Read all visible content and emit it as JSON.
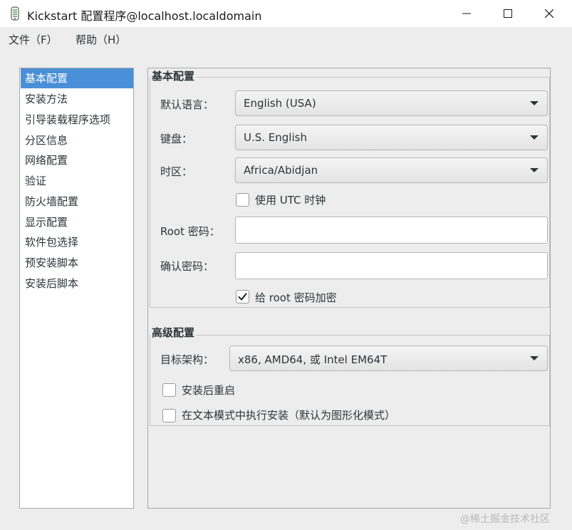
{
  "window": {
    "title": "Kickstart 配置程序@localhost.localdomain",
    "icon": "kickstart-app-icon",
    "controls": [
      "minimize-icon",
      "maximize-icon",
      "close-icon"
    ]
  },
  "menubar": {
    "file": "文件（F）",
    "help": "帮助（H）"
  },
  "sidebar": {
    "items": [
      {
        "label": "基本配置",
        "selected": true
      },
      {
        "label": "安装方法"
      },
      {
        "label": "引导装载程序选项"
      },
      {
        "label": "分区信息"
      },
      {
        "label": "网络配置"
      },
      {
        "label": "验证"
      },
      {
        "label": "防火墙配置"
      },
      {
        "label": "显示配置"
      },
      {
        "label": "软件包选择"
      },
      {
        "label": "预安装脚本"
      },
      {
        "label": "安装后脚本"
      }
    ],
    "selected_color": "#4a90d9"
  },
  "basic": {
    "section_title": "基本配置",
    "language_label": "默认语言：",
    "language_value": "English (USA)",
    "keyboard_label": "键盘：",
    "keyboard_value": "U.S. English",
    "timezone_label": "时区：",
    "timezone_value": "Africa/Abidjan",
    "utc_label": "使用 UTC 时钟",
    "utc_checked": false,
    "root_pw_label": "Root 密码：",
    "root_pw_value": "",
    "confirm_pw_label": "确认密码：",
    "confirm_pw_value": "",
    "encrypt_label": "给 root 密码加密",
    "encrypt_checked": true
  },
  "advanced": {
    "section_title": "高级配置",
    "arch_label": "目标架构：",
    "arch_value": "x86, AMD64, 或 Intel EM64T",
    "reboot_label": "安装后重启",
    "reboot_checked": false,
    "textmode_label": "在文本模式中执行安装（默认为图形化模式）",
    "textmode_checked": false
  },
  "watermark": "@稀土掘金技术社区"
}
